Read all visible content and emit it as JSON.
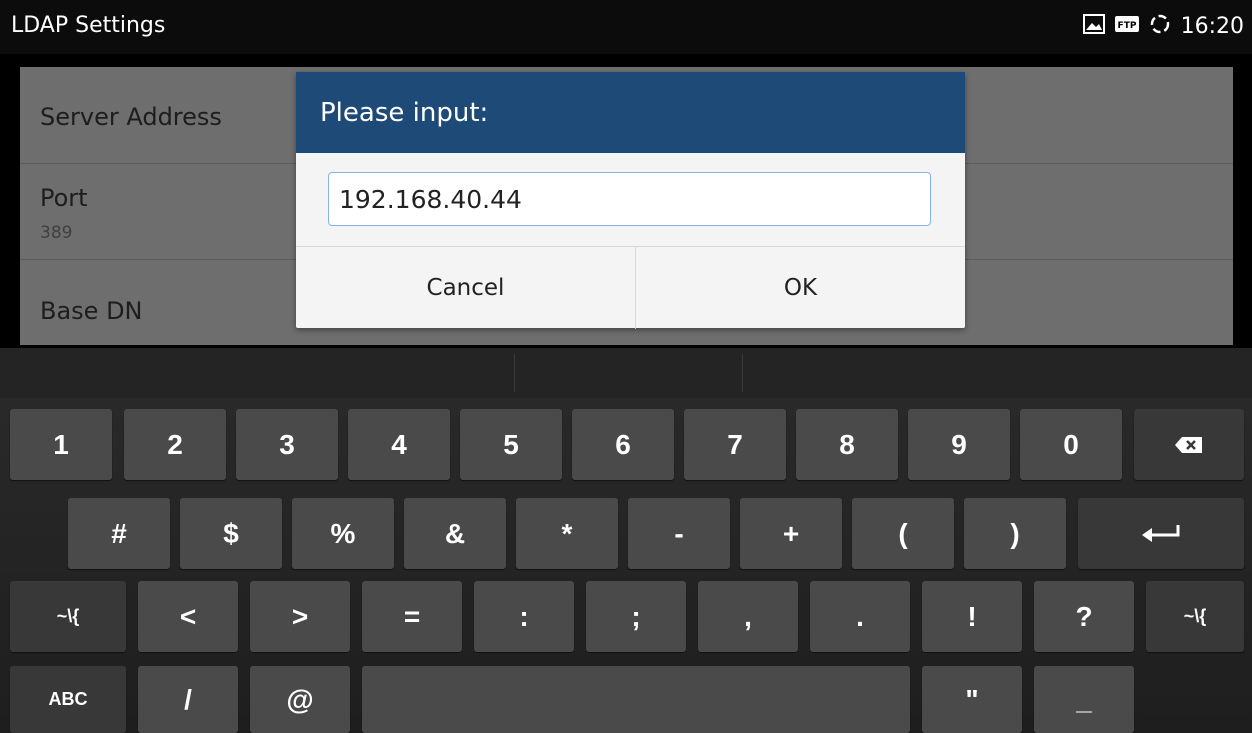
{
  "status_bar": {
    "title": "LDAP Settings",
    "time": "16:20",
    "icons": [
      "image-icon",
      "ftp-icon",
      "sync-icon"
    ]
  },
  "settings": {
    "rows": [
      {
        "label": "Server Address",
        "value": ""
      },
      {
        "label": "Port",
        "value": "389"
      },
      {
        "label": "Base DN",
        "value": ""
      }
    ]
  },
  "dialog": {
    "title": "Please input:",
    "input_value": "192.168.40.44",
    "cancel_label": "Cancel",
    "ok_label": "OK"
  },
  "keyboard": {
    "row1": [
      "1",
      "2",
      "3",
      "4",
      "5",
      "6",
      "7",
      "8",
      "9",
      "0"
    ],
    "row2": [
      "#",
      "$",
      "%",
      "&",
      "*",
      "-",
      "+",
      "(",
      ")"
    ],
    "row3": [
      "<",
      ">",
      "=",
      ":",
      ";",
      ",",
      ".",
      "!",
      "?"
    ],
    "row3_mode_left": "~\\{",
    "row3_mode_right": "~\\{",
    "abc_label": "ABC",
    "row4": [
      "/",
      "@"
    ],
    "quote_key": "\"",
    "underscore_key": "_"
  },
  "colors": {
    "dialog_header": "#1e4a78",
    "input_border": "#86b3e3",
    "key": "#4a4a4a"
  }
}
